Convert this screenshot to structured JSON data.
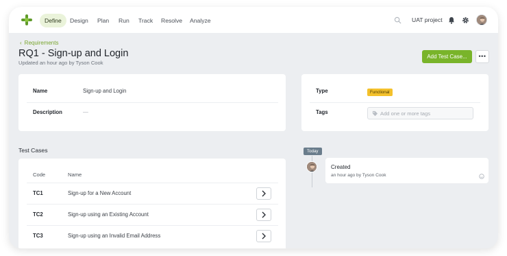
{
  "nav": {
    "items": [
      {
        "label": "Define",
        "active": true
      },
      {
        "label": "Design",
        "active": false
      },
      {
        "label": "Plan",
        "active": false
      },
      {
        "label": "Run",
        "active": false
      },
      {
        "label": "Track",
        "active": false
      },
      {
        "label": "Resolve",
        "active": false
      },
      {
        "label": "Analyze",
        "active": false
      }
    ],
    "project": "UAT project",
    "icons": [
      "search-icon",
      "bell-icon",
      "gear-icon",
      "user-avatar"
    ]
  },
  "header": {
    "back_label": "Requirements",
    "title": "RQ1 - Sign-up and Login",
    "subtitle": "Updated an hour ago by Tyson Cook",
    "primary_button": "Add Test Case...",
    "more_button": "•••"
  },
  "details": {
    "name_label": "Name",
    "name_value": "Sign-up and Login",
    "description_label": "Description",
    "description_value": "—",
    "type_label": "Type",
    "type_value": "Functional",
    "tags_label": "Tags",
    "tags_placeholder": "Add one or more tags"
  },
  "test_cases": {
    "title": "Test Cases",
    "columns": [
      "Code",
      "Name"
    ],
    "rows": [
      {
        "code": "TC1",
        "name": "Sign-up for a New Account"
      },
      {
        "code": "TC2",
        "name": "Sign-up using an Existing Account"
      },
      {
        "code": "TC3",
        "name": "Sign-up using an Invalid Email Address"
      }
    ]
  },
  "activity": {
    "today_label": "Today",
    "title": "Created",
    "subtitle": "an hour ago by Tyson Cook"
  },
  "colors": {
    "accent": "#79b42a",
    "badge": "#f4c12c",
    "background": "#eceef1"
  }
}
